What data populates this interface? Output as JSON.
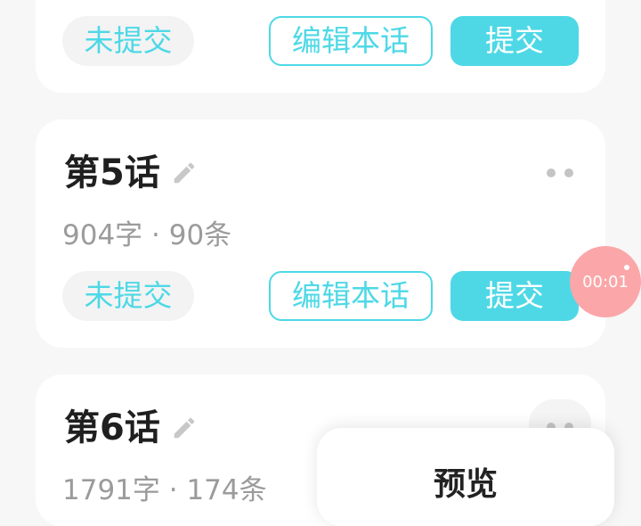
{
  "colors": {
    "accent": "#4ed8e6",
    "background": "#f7f7f7",
    "card": "#ffffff",
    "recorder": "#fba6a8"
  },
  "episodes": [
    {
      "status_label": "未提交",
      "edit_label": "编辑本话",
      "submit_label": "提交"
    },
    {
      "title": "第5话",
      "stats": "904字 · 90条",
      "status_label": "未提交",
      "edit_label": "编辑本话",
      "submit_label": "提交",
      "edit_icon": "pencil-icon",
      "more_icon": "more-icon"
    },
    {
      "title": "第6话",
      "stats": "1791字 · 174条",
      "edit_icon": "pencil-icon",
      "more_icon": "more-icon"
    }
  ],
  "recorder": {
    "time": "00:01"
  },
  "popup": {
    "title": "预览"
  }
}
